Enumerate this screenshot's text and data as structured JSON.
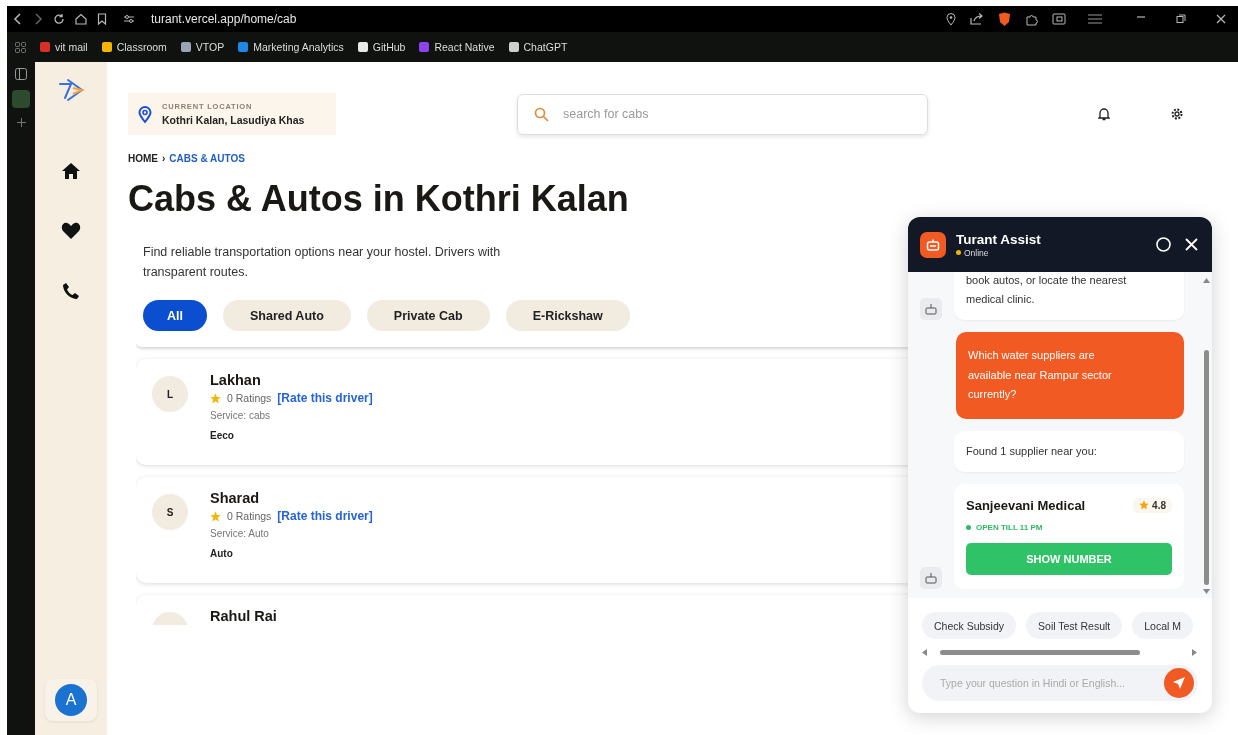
{
  "browser": {
    "url": "turant.vercel.app/home/cab",
    "bookmarks": [
      {
        "label": "vit mail",
        "color": "#d93025"
      },
      {
        "label": "Classroom",
        "color": "#f4b400"
      },
      {
        "label": "VTOP",
        "color": "#9aa4b2"
      },
      {
        "label": "Marketing Analytics",
        "color": "#1e88e5"
      },
      {
        "label": "GitHub",
        "color": "#e8e8e8"
      },
      {
        "label": "React Native",
        "color": "#8e44ec"
      },
      {
        "label": "ChatGPT",
        "color": "#cfcfcf"
      }
    ]
  },
  "sidebar": {
    "items": [
      {
        "kind": "home"
      },
      {
        "kind": "heart"
      },
      {
        "kind": "phone"
      }
    ],
    "avatar": "A"
  },
  "location": {
    "label": "CURRENT LOCATION",
    "value": "Kothri Kalan, Lasudiya Khas"
  },
  "search": {
    "placeholder": "search for cabs"
  },
  "breadcrumb": [
    {
      "label": "HOME",
      "current": false
    },
    {
      "label": "CABS & AUTOS",
      "current": true
    }
  ],
  "breadcrumb_separator": "›",
  "title": "Cabs & Autos in Kothri Kalan",
  "description": "Find reliable transportation options near your hostel. Drivers with transparent routes.",
  "filters": [
    {
      "label": "All",
      "selected": true
    },
    {
      "label": "Shared Auto",
      "selected": false
    },
    {
      "label": "Private Cab",
      "selected": false
    },
    {
      "label": "E-Rickshaw",
      "selected": false
    }
  ],
  "drivers": [
    {
      "initials": "L",
      "name": "Lakhan",
      "ratings": "0 Ratings",
      "rate_link": "[Rate this driver]",
      "service": "Service: cabs",
      "vehicle": "Eeco"
    },
    {
      "initials": "S",
      "name": "Sharad",
      "ratings": "0 Ratings",
      "rate_link": "[Rate this driver]",
      "service": "Service: Auto",
      "vehicle": "Auto"
    },
    {
      "name": "Rahul Rai"
    }
  ],
  "chat": {
    "title": "Turant Assist",
    "status": "Online",
    "messages": [
      {
        "kind": "bot",
        "text": "book autos, or locate the nearest medical clinic."
      },
      {
        "kind": "user",
        "text": "Which water suppliers are available near Rampur sector currently?"
      },
      {
        "kind": "bot",
        "text": "Found 1 supplier near you:"
      },
      {
        "kind": "supplier",
        "name": "Sanjeevani Medical",
        "rating": "4.8",
        "status": "OPEN TILL 11 PM",
        "button": "SHOW NUMBER"
      }
    ],
    "quick_replies": [
      "Check Subsidy",
      "Soil Test Result",
      "Local M"
    ],
    "input": {
      "placeholder": "Type your question in Hindi or English..."
    }
  }
}
